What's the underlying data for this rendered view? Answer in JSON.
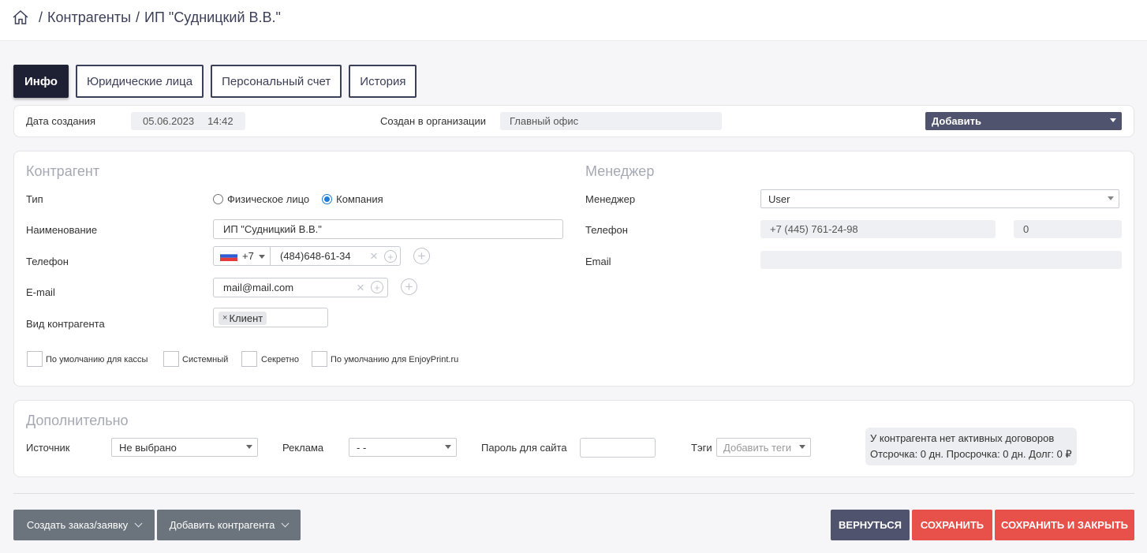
{
  "breadcrumb": {
    "items": [
      "Контрагенты",
      "ИП \"Судницкий В.В.\""
    ],
    "separator": "/"
  },
  "tabs": [
    {
      "label": "Инфо",
      "active": true
    },
    {
      "label": "Юридические лица",
      "active": false
    },
    {
      "label": "Персональный счет",
      "active": false
    },
    {
      "label": "История",
      "active": false
    }
  ],
  "info": {
    "created_label": "Дата создания",
    "created_date": "05.06.2023",
    "created_time": "14:42",
    "org_label": "Создан в организации",
    "org_value": "Главный офис",
    "add_select": "Добавить"
  },
  "counterparty": {
    "title": "Контрагент",
    "type_label": "Тип",
    "type_options": [
      "Физическое лицо",
      "Компания"
    ],
    "type_selected": "Компания",
    "name_label": "Наименование",
    "name_value": "ИП \"Судницкий В.В.\"",
    "phone_label": "Телефон",
    "phone_code": "+7",
    "phone_value": "(484)648-61-34",
    "email_label": "E-mail",
    "email_value": "mail@mail.com",
    "kind_label": "Вид контрагента",
    "kind_tag": "Клиент",
    "checkboxes": [
      "По умолчанию для кассы",
      "Системный",
      "Секретно",
      "По умолчанию для EnjoyPrint.ru"
    ]
  },
  "manager": {
    "title": "Менеджер",
    "manager_label": "Менеджер",
    "manager_value": "User",
    "phone_label": "Телефон",
    "phone_value": "+7 (445) 761-24-98",
    "ext_value": "0",
    "email_label": "Email",
    "email_value": ""
  },
  "extra": {
    "title": "Дополнительно",
    "source_label": "Источник",
    "source_value": "Не выбрано",
    "ad_label": "Реклама",
    "ad_value": "- -",
    "password_label": "Пароль для сайта",
    "password_value": "",
    "tags_label": "Тэги",
    "tags_placeholder": "Добавить теги",
    "contract_line1": "У контрагента нет активных договоров",
    "contract_line2": "Отсрочка: 0 дн. Просрочка: 0 дн. Долг: 0 ₽"
  },
  "footer": {
    "create_order": "Создать заказ/заявку",
    "add_counterparty": "Добавить контрагента",
    "back": "ВЕРНУТЬСЯ",
    "save": "СОХРАНИТЬ",
    "save_close": "СОХРАНИТЬ И ЗАКРЫТЬ"
  },
  "colors": {
    "accent_dark": "#1e2033",
    "navy": "#50536d",
    "red": "#e8504a",
    "gray_button": "#6b747d",
    "radio_blue": "#1e7cd6"
  },
  "icons": {
    "home": "home-icon",
    "flag": "russia-flag-icon"
  }
}
